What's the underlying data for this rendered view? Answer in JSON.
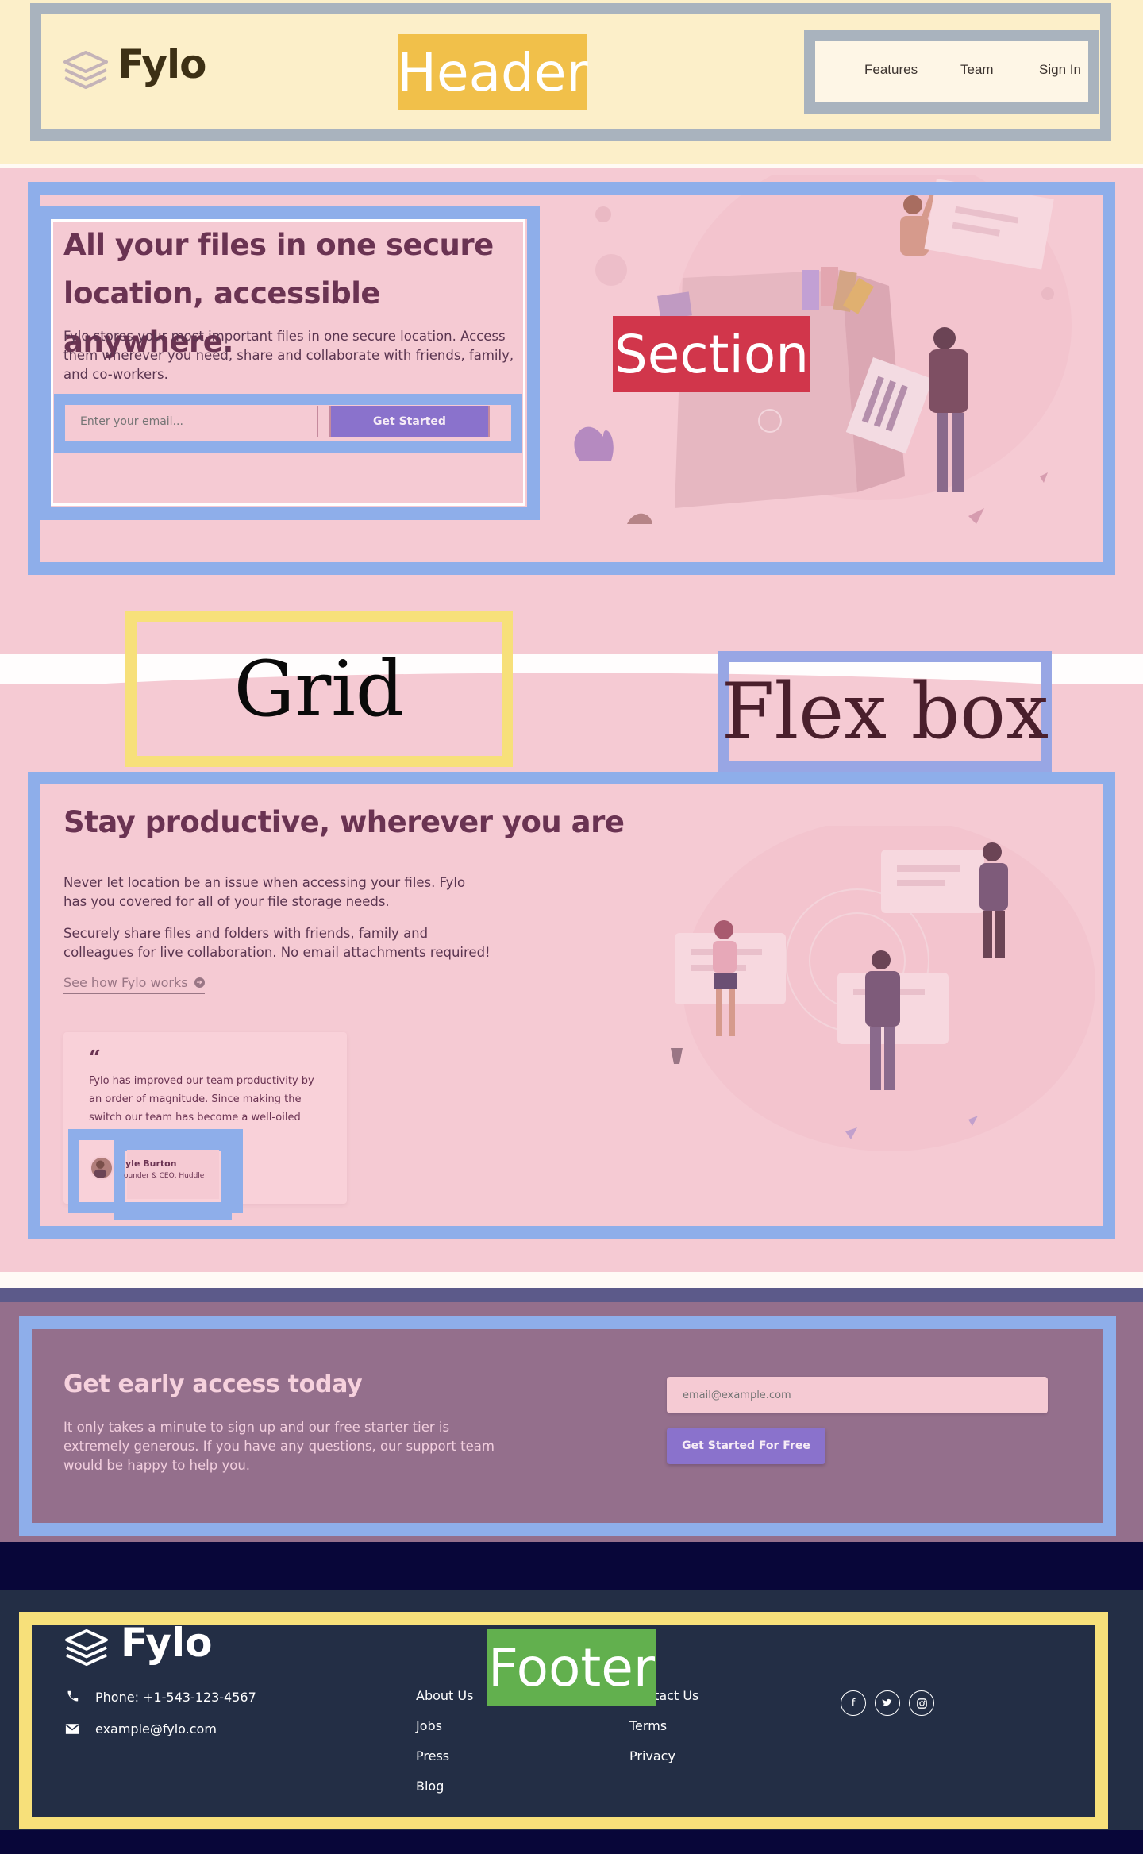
{
  "header": {
    "logo_text": "Fylo",
    "label": "Header",
    "nav": [
      "Features",
      "Team",
      "Sign In"
    ]
  },
  "hero": {
    "title": "All your files in one secure location, accessible anywhere.",
    "description": "Fylo stores your most important files in one secure location. Access them wherever you need, share and collaborate with friends, family, and co-workers.",
    "email_placeholder": "Enter your email...",
    "cta_label": "Get Started",
    "label": "Section"
  },
  "labels": {
    "grid": "Grid",
    "flexbox": "Flex box"
  },
  "productive": {
    "title": "Stay productive, wherever you are",
    "paragraph1": "Never let location be an issue when accessing your files. Fylo has you covered for all of your file storage needs.",
    "paragraph2": "Securely share files and folders with friends, family and colleagues for live collaboration. No email attachments required!",
    "link_label": "See how Fylo works",
    "testimonial": {
      "quote_mark": "“",
      "text": "Fylo has improved our team productivity by an order of magnitude. Since making the switch our team has become a well-oiled",
      "author_name": "yle Burton",
      "author_role": "ounder & CEO, Huddle"
    }
  },
  "early_access": {
    "title": "Get early access today",
    "description": "It only takes a minute to sign up and our free starter tier is extremely generous. If you have any questions, our support team would be happy to help you.",
    "email_placeholder": "email@example.com",
    "cta_label": "Get Started For Free"
  },
  "footer": {
    "logo_text": "Fylo",
    "label": "Footer",
    "phone": "Phone: +1-543-123-4567",
    "email": "example@fylo.com",
    "links_col1": [
      "About Us",
      "Jobs",
      "Press",
      "Blog"
    ],
    "links_col2": [
      "Contact Us",
      "Terms",
      "Privacy"
    ],
    "social": [
      "facebook-icon",
      "twitter-icon",
      "instagram-icon"
    ]
  },
  "colors": {
    "header_bg": "#fcefc9",
    "section_bg": "#f5cad3",
    "frame_blue": "#8eaeea",
    "frame_yellow": "#f7e07a",
    "header_frame_gray": "#a9b3be",
    "header_label_bg": "#f1c04a",
    "section_label_bg": "#d1364b",
    "footer_label_bg": "#62b04e",
    "cta": "#8a72cc",
    "heading": "#6a3352",
    "early_access_bg": "#946f8c",
    "footer_bg": "#232e45",
    "navy": "#080639"
  }
}
